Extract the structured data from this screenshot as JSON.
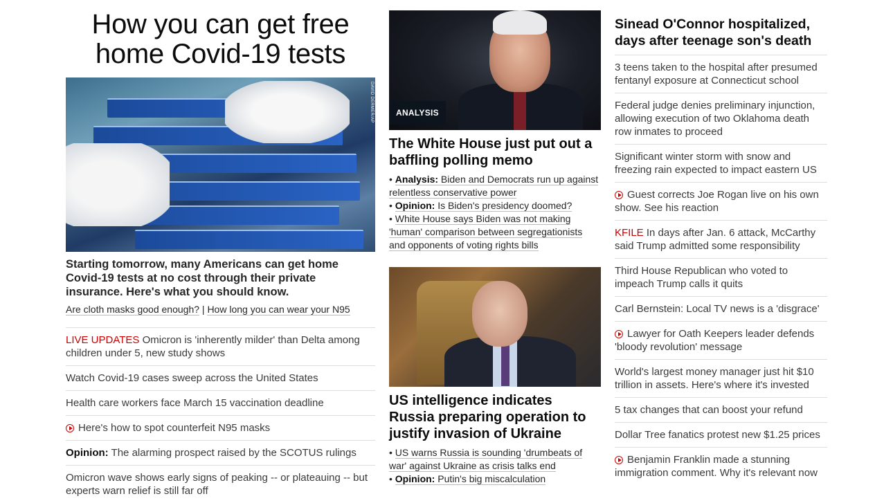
{
  "col1": {
    "hero_title": "How you can get free home Covid-19 tests",
    "photo_credit": "DAVID DERMER/AP",
    "lead_text": "Starting tomorrow, many Americans can get home Covid-19 tests at no cost through their private insurance. Here's what you should know.",
    "sublink_1": "Are cloth masks good enough?",
    "sublink_sep": " | ",
    "sublink_2": "How long you can wear your N95",
    "items": [
      {
        "prefix": "LIVE UPDATES",
        "text": " Omicron is 'inherently milder' than Delta among children under 5, new study shows"
      },
      {
        "text": "Watch Covid-19 cases sweep across the United States"
      },
      {
        "text": "Health care workers face March 15 vaccination deadline"
      },
      {
        "text": "Here's how to spot counterfeit N95 masks",
        "icon": "play-icon"
      },
      {
        "prefix": "Opinion:",
        "text": " The alarming prospect raised by the SCOTUS rulings"
      },
      {
        "text": "Omicron wave shows early signs of peaking -- or plateauing -- but experts warn relief is still far off"
      }
    ]
  },
  "col2": {
    "story1": {
      "badge": "ANALYSIS",
      "title": "The White House just put out a baffling polling memo",
      "b1_label": "Analysis:",
      "b1_text": " Biden and Democrats run up against relentless conservative power",
      "b2_label": "Opinion:",
      "b2_text": " Is Biden's presidency doomed?",
      "b3_text": "White House says Biden was not making 'human' comparison between segregationists and opponents of voting rights bills"
    },
    "story2": {
      "title": "US intelligence indicates Russia preparing operation to justify invasion of Ukraine",
      "b1_text": "US warns Russia is sounding 'drumbeats of war' against Ukraine as crisis talks end",
      "b2_label": "Opinion:",
      "b2_text": " Putin's big miscalculation"
    }
  },
  "col3": {
    "headline": "Sinead O'Connor hospitalized, days after teenage son's death",
    "items": [
      {
        "text": "3 teens taken to the hospital after presumed fentanyl exposure at Connecticut school"
      },
      {
        "text": "Federal judge denies preliminary injunction, allowing execution of two Oklahoma death row inmates to proceed"
      },
      {
        "text": "Significant winter storm with snow and freezing rain expected to impact eastern US"
      },
      {
        "text": "Guest corrects Joe Rogan live on his own show. See his reaction",
        "icon": "play-icon"
      },
      {
        "prefix": "KFILE",
        "text": " In days after Jan. 6 attack, McCarthy said Trump admitted some responsibility"
      },
      {
        "text": "Third House Republican who voted to impeach Trump calls it quits"
      },
      {
        "text": "Carl Bernstein: Local TV news is a 'disgrace'"
      },
      {
        "text": "Lawyer for Oath Keepers leader defends 'bloody revolution' message",
        "icon": "play-icon"
      },
      {
        "text": "World's largest money manager just hit $10 trillion in assets. Here's where it's invested"
      },
      {
        "text": "5 tax changes that can boost your refund"
      },
      {
        "text": "Dollar Tree fanatics protest new $1.25 prices"
      },
      {
        "text": "Benjamin Franklin made a stunning immigration comment. Why it's relevant now",
        "icon": "play-icon"
      }
    ]
  },
  "colors": {
    "accent_red": "#cc0000",
    "text": "#262626",
    "divider": "#dddddd"
  }
}
